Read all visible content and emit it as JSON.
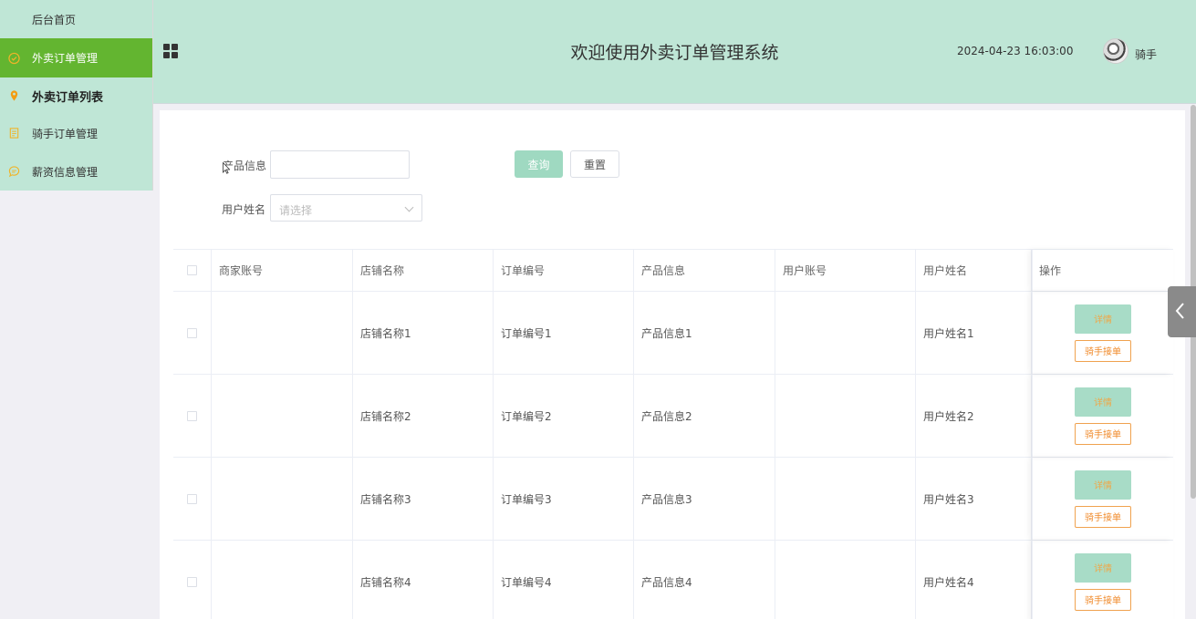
{
  "sidebar": {
    "home": "后台首页",
    "items": [
      {
        "label": "外卖订单管理",
        "icon": "check-circle-icon"
      },
      {
        "label": "外卖订单列表",
        "icon": "location-pin-icon"
      },
      {
        "label": "骑手订单管理",
        "icon": "document-icon"
      },
      {
        "label": "薪资信息管理",
        "icon": "chat-bubble-icon"
      }
    ]
  },
  "header": {
    "title": "欢迎使用外卖订单管理系统",
    "datetime": "2024-04-23 16:03:00",
    "username": "骑手"
  },
  "filters": {
    "product_label": "产品信息",
    "product_value": "",
    "username_label": "用户姓名",
    "username_placeholder": "请选择",
    "query_button": "查询",
    "reset_button": "重置"
  },
  "table": {
    "columns": [
      "商家账号",
      "店铺名称",
      "订单编号",
      "产品信息",
      "用户账号",
      "用户姓名",
      "操作"
    ],
    "rows": [
      {
        "merchant": "",
        "shop": "店铺名称1",
        "order": "订单编号1",
        "product": "产品信息1",
        "account": "",
        "user": "用户姓名1"
      },
      {
        "merchant": "",
        "shop": "店铺名称2",
        "order": "订单编号2",
        "product": "产品信息2",
        "account": "",
        "user": "用户姓名2"
      },
      {
        "merchant": "",
        "shop": "店铺名称3",
        "order": "订单编号3",
        "product": "产品信息3",
        "account": "",
        "user": "用户姓名3"
      },
      {
        "merchant": "",
        "shop": "店铺名称4",
        "order": "订单编号4",
        "product": "产品信息4",
        "account": "",
        "user": "用户姓名4"
      }
    ],
    "actions": {
      "detail": "详情",
      "rider_accept": "骑手接单"
    }
  },
  "colors": {
    "accent": "#bfe6d6",
    "active_menu": "#63b530",
    "query_button": "#9fd9c1",
    "action_orange": "#f08a2a"
  }
}
